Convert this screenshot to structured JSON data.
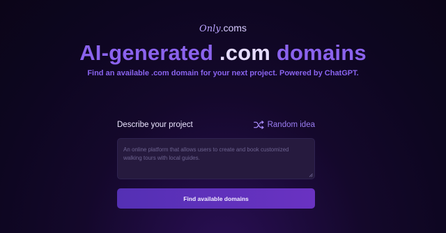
{
  "brand": {
    "script": "Only",
    "tld": ".coms"
  },
  "hero": {
    "title_part1": "AI-generated",
    "title_part2": ".com",
    "title_part3": "domains",
    "subtitle": "Find an available .com domain for your next project. Powered by ChatGPT."
  },
  "form": {
    "label": "Describe your project",
    "random_label": "Random idea",
    "placeholder": "An online platform that allows users to create and book customized walking tours with local guides.",
    "value": "",
    "submit_label": "Find available domains"
  },
  "icons": {
    "random": "shuffle-icon"
  },
  "colors": {
    "accent": "#8b63ee",
    "button": "#5a30b8",
    "background": "#120828"
  }
}
